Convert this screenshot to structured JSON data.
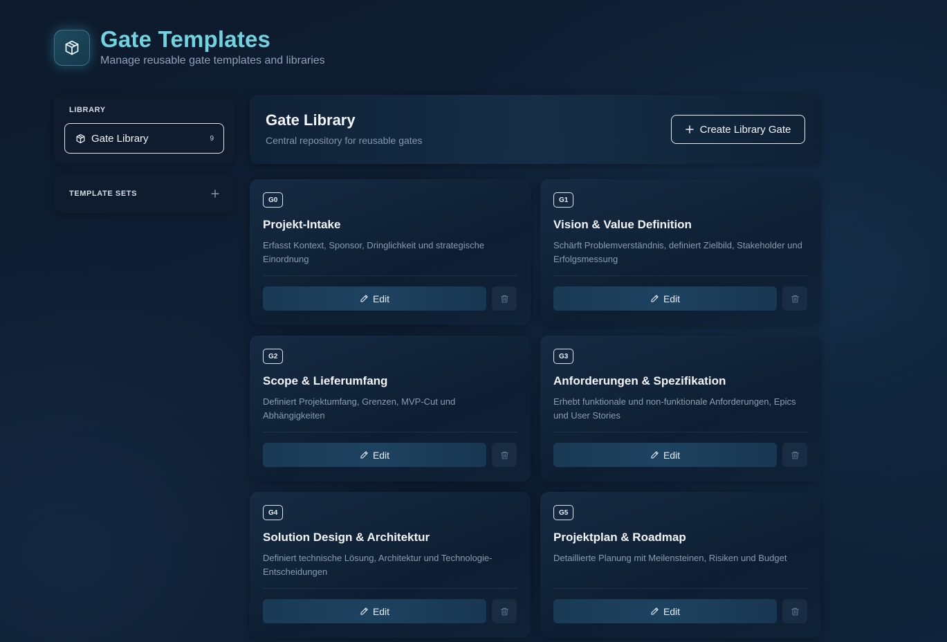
{
  "header": {
    "title": "Gate Templates",
    "subtitle": "Manage reusable gate templates and libraries",
    "icon": "package-icon"
  },
  "sidebar": {
    "library_heading": "LIBRARY",
    "library_item": {
      "label": "Gate Library",
      "count": "9",
      "icon": "package-icon"
    },
    "template_sets_heading": "TEMPLATE SETS",
    "add_icon": "plus-icon"
  },
  "main": {
    "title": "Gate Library",
    "subtitle": "Central repository for reusable gates",
    "create_button": "Create Library Gate"
  },
  "gates": [
    {
      "badge": "G0",
      "title": "Projekt-Intake",
      "description": "Erfasst Kontext, Sponsor, Dringlichkeit und strategische Einordnung",
      "edit_label": "Edit"
    },
    {
      "badge": "G1",
      "title": "Vision & Value Definition",
      "description": "Schärft Problemverständnis, definiert Zielbild, Stakeholder und Erfolgsmessung",
      "edit_label": "Edit"
    },
    {
      "badge": "G2",
      "title": "Scope & Lieferumfang",
      "description": "Definiert Projektumfang, Grenzen, MVP-Cut und Abhängigkeiten",
      "edit_label": "Edit"
    },
    {
      "badge": "G3",
      "title": "Anforderungen & Spezifikation",
      "description": "Erhebt funktionale und non-funktionale Anforderungen, Epics und User Stories",
      "edit_label": "Edit"
    },
    {
      "badge": "G4",
      "title": "Solution Design & Architektur",
      "description": "Definiert technische Lösung, Architektur und Technologie-Entscheidungen",
      "edit_label": "Edit"
    },
    {
      "badge": "G5",
      "title": "Projektplan & Roadmap",
      "description": "Detaillierte Planung mit Meilensteinen, Risiken und Budget",
      "edit_label": "Edit"
    }
  ],
  "colors": {
    "accent": "#6fd3e0",
    "background": "#0f1e33"
  }
}
